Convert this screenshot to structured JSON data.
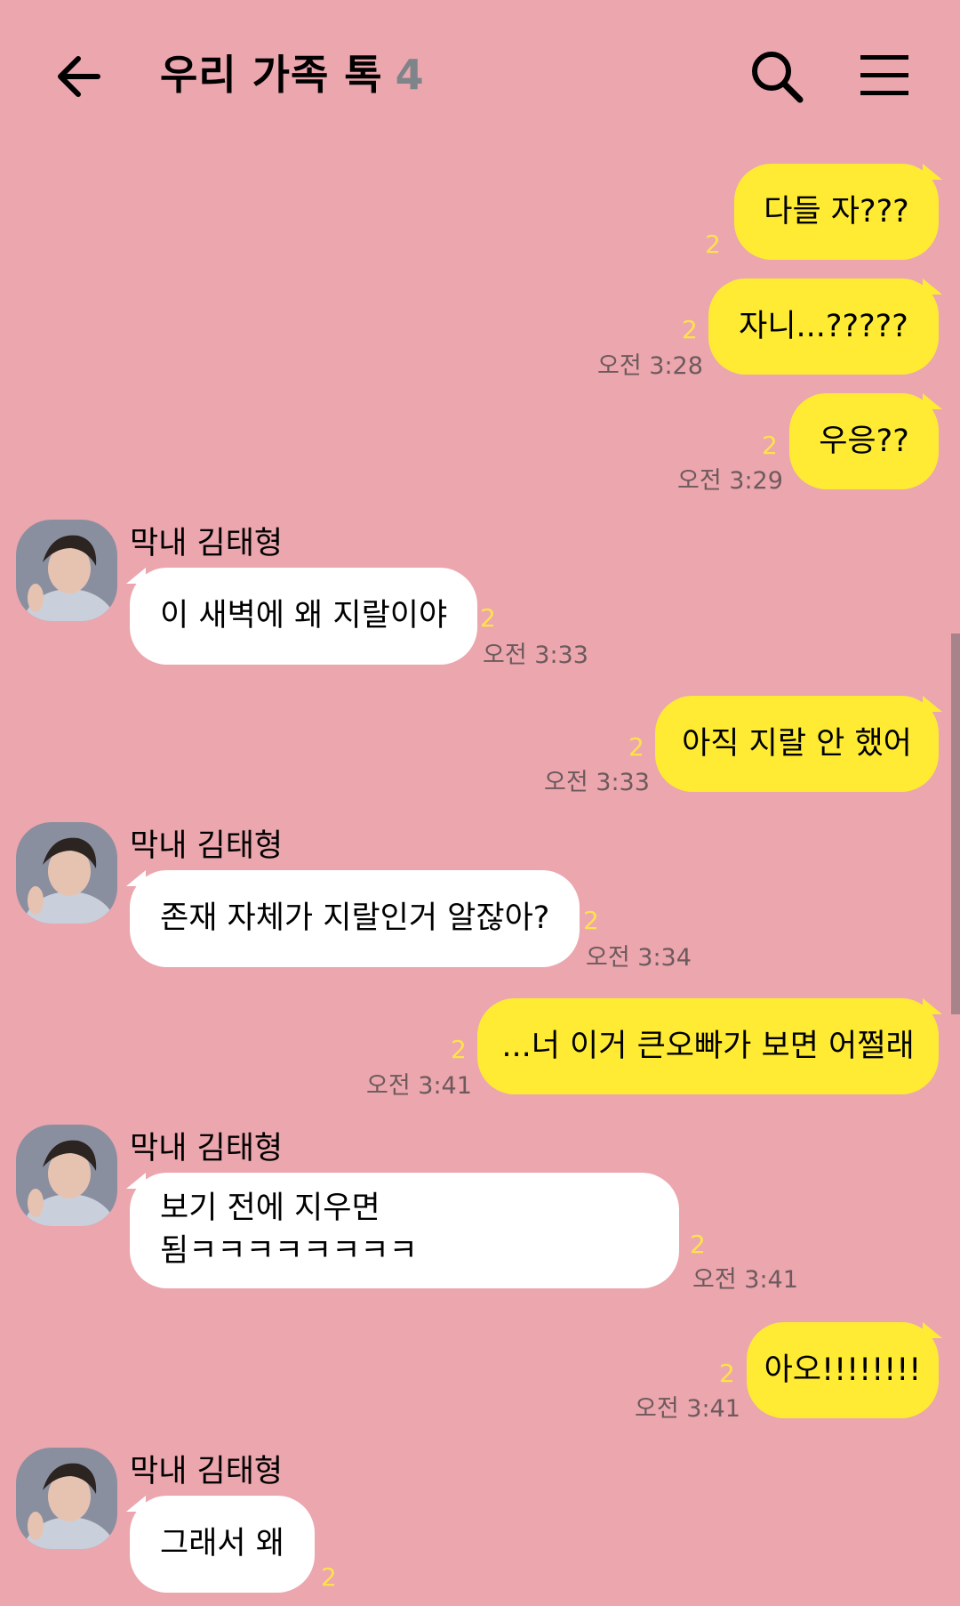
{
  "header": {
    "back_icon": "arrow-left-icon",
    "title": "우리 가족 톡",
    "member_count": "4",
    "search_icon": "search-icon",
    "menu_icon": "hamburger-menu-icon"
  },
  "colors": {
    "background": "#eba6ae",
    "my_bubble": "#ffeb33",
    "other_bubble": "#ffffff",
    "unread": "#ffe24a",
    "time": "#6d5a5d",
    "count": "#7d848a"
  },
  "messages": [
    {
      "text": "다들 자???",
      "unread": "2",
      "time": ""
    },
    {
      "text": "자니...?????",
      "unread": "2",
      "time": "오전 3:28"
    },
    {
      "text": "우응??",
      "unread": "2",
      "time": "오전 3:29"
    },
    {
      "sender": "막내 김태형",
      "text": "이 새벽에 왜 지랄이야",
      "unread": "2",
      "time": "오전 3:33"
    },
    {
      "text": "아직 지랄 안 했어",
      "unread": "2",
      "time": "오전 3:33"
    },
    {
      "sender": "막내 김태형",
      "text": "존재 자체가 지랄인거 알잖아?",
      "unread": "2",
      "time": "오전 3:34"
    },
    {
      "text": "...너 이거 큰오빠가 보면 어쩔래",
      "unread": "2",
      "time": "오전 3:41"
    },
    {
      "sender": "막내 김태형",
      "text_line1": "보기 전에 지우면",
      "text_line2": "됨ㅋㅋㅋㅋㅋㅋㅋㅋ",
      "unread": "2",
      "time": "오전 3:41"
    },
    {
      "text": "아오!!!!!!!!",
      "unread": "2",
      "time": "오전 3:41"
    },
    {
      "sender": "막내 김태형",
      "text": "그래서 왜",
      "unread": "2",
      "time": ""
    }
  ]
}
